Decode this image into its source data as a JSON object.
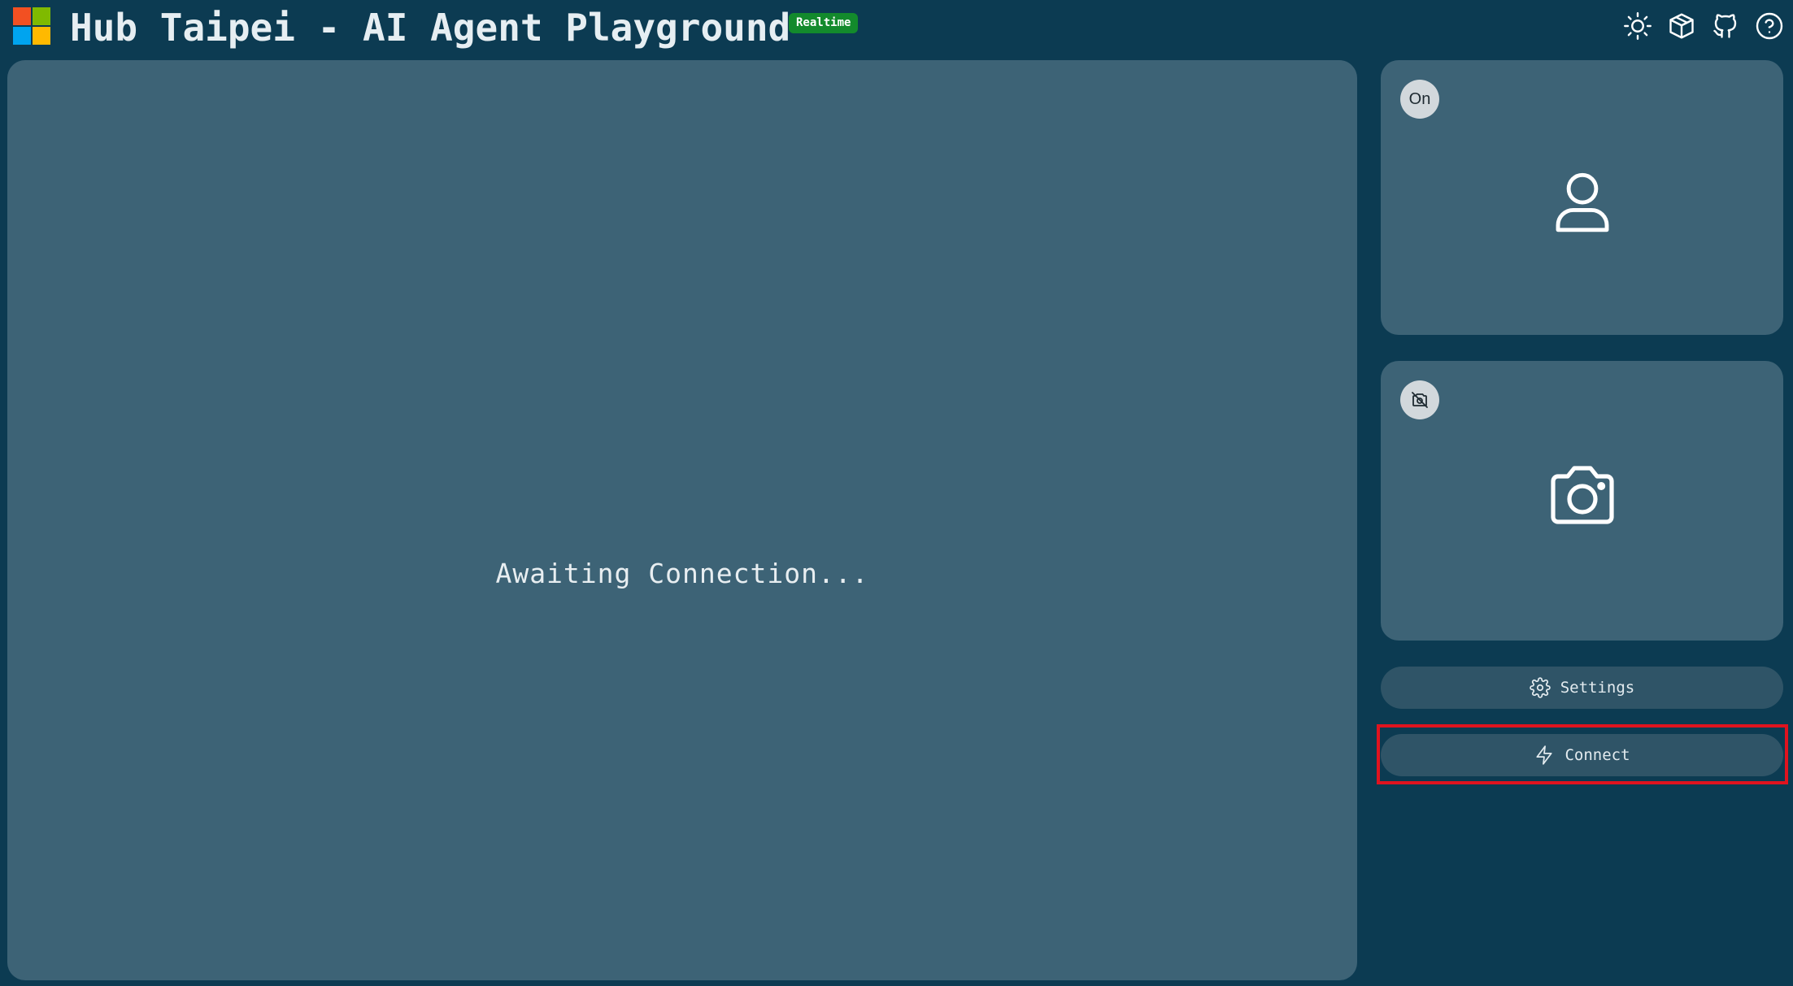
{
  "header": {
    "title": "Hub Taipei - AI Agent Playground",
    "badge": "Realtime",
    "icons": [
      "sun-icon",
      "cube-icon",
      "github-icon",
      "help-icon"
    ]
  },
  "main": {
    "status_text": "Awaiting Connection..."
  },
  "sidebar": {
    "mic_card": {
      "toggle_label": "On",
      "icon": "user-icon"
    },
    "camera_card": {
      "toggle_icon": "camera-off-icon",
      "icon": "camera-icon"
    },
    "settings_label": "Settings",
    "connect_label": "Connect"
  },
  "colors": {
    "background": "#0c3b52",
    "panel": "#3d6376",
    "button": "#2f5467",
    "badge": "#138a2c",
    "highlight": "#e0131f"
  }
}
